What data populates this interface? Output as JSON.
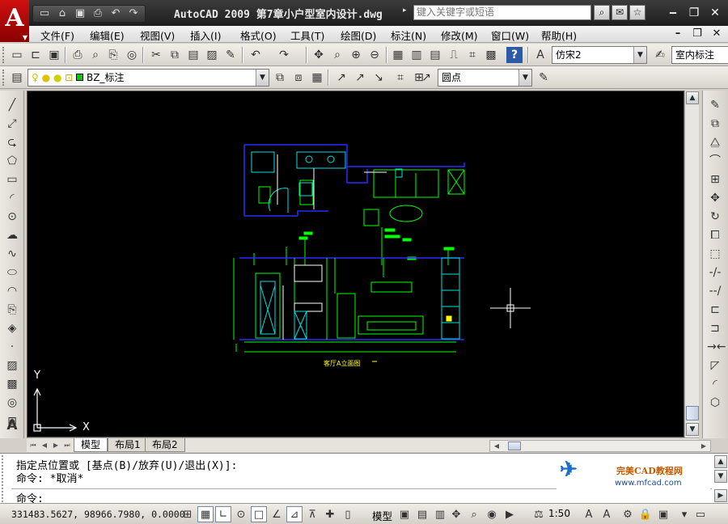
{
  "window": {
    "title": "AutoCAD 2009  第7章小户型室内设计.dwg",
    "search_placeholder": "键入关键字或短语"
  },
  "menu": {
    "items": [
      "文件(F)",
      "编辑(E)",
      "视图(V)",
      "插入(I)",
      "格式(O)",
      "工具(T)",
      "绘图(D)",
      "标注(N)",
      "修改(M)",
      "窗口(W)",
      "帮助(H)"
    ]
  },
  "toolbar1": {
    "text_style": "仿宋2",
    "dim_style": "室内标注"
  },
  "toolbar2": {
    "layer": "BZ_标注",
    "layer_color": "#00cc00",
    "multileader_style": "圆点"
  },
  "drawing": {
    "background": "#000000",
    "plan_title": "客厅A立面图",
    "ucs_x": "X",
    "ucs_y": "Y"
  },
  "layout_tabs": [
    "模型",
    "布局1",
    "布局2"
  ],
  "command": {
    "history_1": "指定点位置或 [基点(B)/放弃(U)/退出(X)]:",
    "history_2": "命令: *取消*",
    "prompt": "命令:"
  },
  "watermark": {
    "title": "完美CAD教程网",
    "url": "www.mfcad.com"
  },
  "status": {
    "coordinates": "331483.5627, 98966.7980, 0.0000",
    "model_label": "模型",
    "annotation_scale": "1:50"
  },
  "icons": {
    "title_qat": [
      "new-icon",
      "open-icon",
      "save-icon",
      "plot-icon",
      "undo-icon",
      "redo-icon"
    ],
    "info_tools": [
      "search-icon",
      "communication-center-icon",
      "favorites-icon"
    ]
  }
}
